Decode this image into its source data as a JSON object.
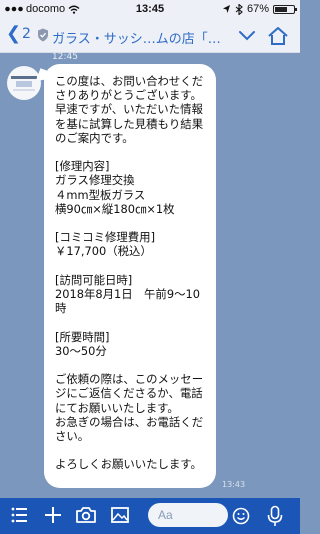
{
  "status_bar": {
    "carrier": "docomo",
    "time": "13:45",
    "battery_percent": "67%",
    "battery_level": 0.67
  },
  "header": {
    "unread_count": "2",
    "chat_title": "ガラス・サッシ…ムの店「窓名人」"
  },
  "partial_timestamp": "12:45",
  "message": {
    "text": "この度は、お問い合わせくださりありがとうございます。\n早速ですが、いただいた情報を基に試算した見積もり結果のご案内です。\n\n[修理内容]\nガラス修理交換\n４mm型板ガラス\n横90㎝×縦180㎝×1枚\n\n[コミコミ修理費用]\n￥17,700（税込）\n\n[訪問可能日時]\n2018年8月1日　午前9～10時\n\n[所要時間]\n30～50分\n\nご依頼の際は、このメッセージにご返信くださるか、電話にてお願いいたします。\nお急ぎの場合は、お電話ください。\n\nよろしくお願いいたします。",
    "time": "13:43"
  },
  "toolbar": {
    "input_placeholder": "Aa"
  }
}
